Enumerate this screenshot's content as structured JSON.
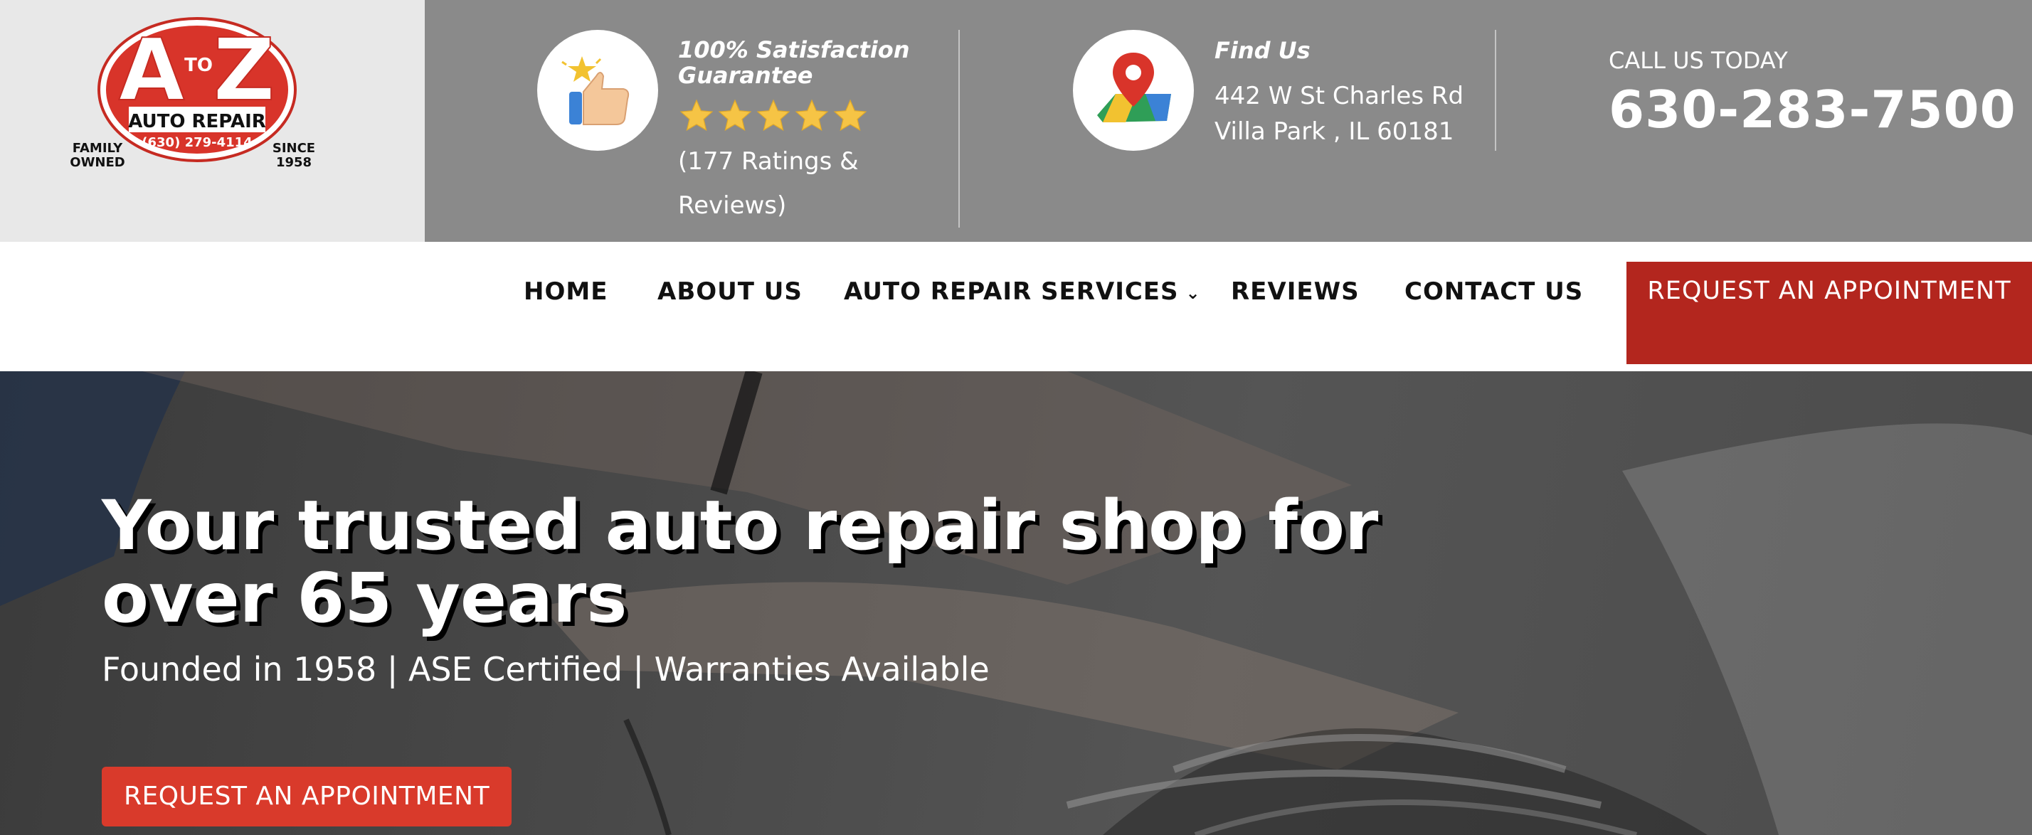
{
  "colors": {
    "brand_red": "#b3261e",
    "cta_red": "#d93a2b",
    "topbar_gray": "#8a8a8a",
    "logo_bg": "#e8e8e8"
  },
  "logo": {
    "letters": "A",
    "to": "TO",
    "letter_z": "Z",
    "name": "AUTO REPAIR",
    "phone": "(630) 279-4114",
    "left_tag": [
      "FAMILY",
      "OWNED"
    ],
    "right_tag": [
      "SINCE",
      "1958"
    ]
  },
  "satisfaction": {
    "icon": "thumbs-up-icon",
    "title": "100% Satisfaction Guarantee",
    "rating": 5,
    "ratings_text": "(177 Ratings & Reviews)"
  },
  "find_us": {
    "icon": "map-pin-icon",
    "title": "Find Us",
    "address_line1": "442 W St Charles Rd",
    "address_line2": "Villa Park , IL 60181"
  },
  "call": {
    "label": "CALL US TODAY",
    "phone": "630-283-7500"
  },
  "nav": {
    "items": [
      {
        "label": "HOME"
      },
      {
        "label": "ABOUT US"
      },
      {
        "label": "AUTO REPAIR SERVICES",
        "chevron": "⌄"
      },
      {
        "label": "REVIEWS"
      },
      {
        "label": "CONTACT US"
      }
    ],
    "cta": "REQUEST AN APPOINTMENT"
  },
  "hero": {
    "title": "Your trusted auto repair shop for over 65 years",
    "subtitle": "Founded in 1958 | ASE Certified | Warranties Available",
    "cta": "REQUEST AN APPOINTMENT"
  }
}
